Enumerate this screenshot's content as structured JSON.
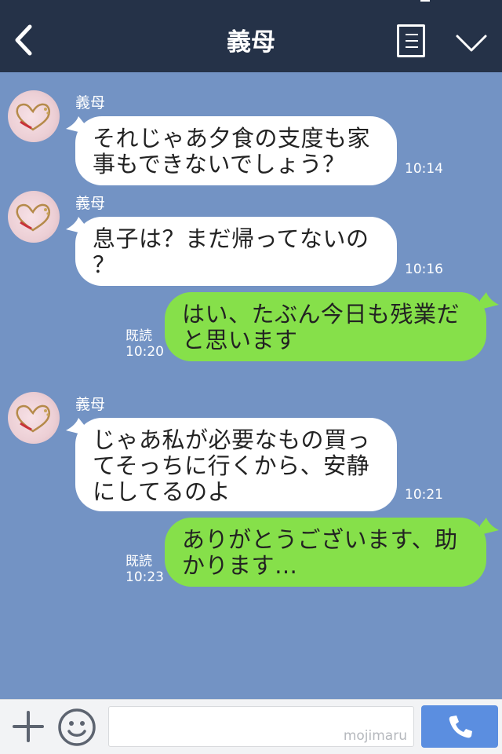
{
  "header": {
    "title": "義母"
  },
  "messages": [
    {
      "sender": "義母",
      "text_lines": [
        "それじゃあ夕食の支度も家",
        "事もできないでしょう？"
      ],
      "time": "10:14"
    },
    {
      "sender": "義母",
      "text_lines": [
        "息子は？まだ帰ってないの",
        "？"
      ],
      "time": "10:16"
    },
    {
      "read": "既読",
      "text_lines": [
        "はい、たぶん今日も残業だ",
        "と思います"
      ],
      "time": "10:20"
    },
    {
      "sender": "義母",
      "text_lines": [
        "じゃあ私が必要なもの買っ",
        "てそっちに行くから、安静",
        "にしてるのよ"
      ],
      "time": "10:21"
    },
    {
      "read": "既読",
      "text_lines": [
        "ありがとうございます、助",
        "かります…"
      ],
      "time": "10:23"
    }
  ],
  "footer": {
    "watermark": "mojimaru"
  },
  "colors": {
    "header_bg": "#253248",
    "chat_bg": "#7393c4",
    "outgoing_bubble": "#86e04a",
    "incoming_bubble": "#ffffff",
    "call_button": "#5b8ee0"
  },
  "icons": [
    "back-arrow-icon",
    "menu-list-icon",
    "chevron-down-icon",
    "plus-icon",
    "smiley-icon",
    "phone-icon"
  ]
}
